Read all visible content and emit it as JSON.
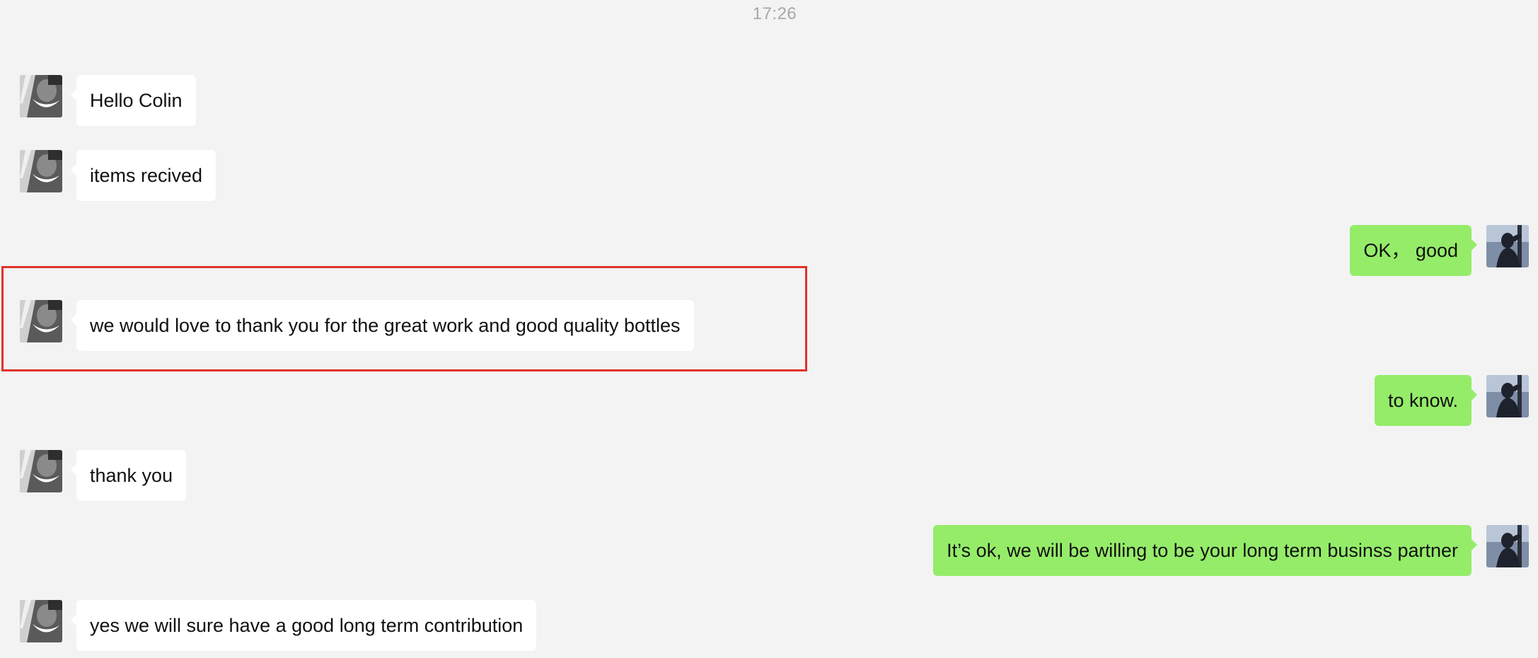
{
  "chat": {
    "timestamp": "17:26",
    "messages": [
      {
        "sender": "contact",
        "text": "Hello Colin"
      },
      {
        "sender": "contact",
        "text": "items recived"
      },
      {
        "sender": "self",
        "text": "OK， good"
      },
      {
        "sender": "contact",
        "text": "we would love to thank you for the great work and good quality bottles"
      },
      {
        "sender": "self",
        "text": "to know."
      },
      {
        "sender": "contact",
        "text": "thank you"
      },
      {
        "sender": "self",
        "text": "It’s ok, we will be willing to be your long term businss partner"
      },
      {
        "sender": "contact",
        "text": "yes we will sure have a good long term contribution"
      }
    ]
  },
  "colors": {
    "background": "#f3f3f3",
    "incoming_bubble": "#ffffff",
    "outgoing_bubble": "#95ec69",
    "highlight_border": "#e0322a",
    "timestamp_text": "#a8a8a8"
  },
  "icons": {
    "contact_avatar": "contact-avatar-icon",
    "self_avatar": "self-avatar-icon"
  }
}
